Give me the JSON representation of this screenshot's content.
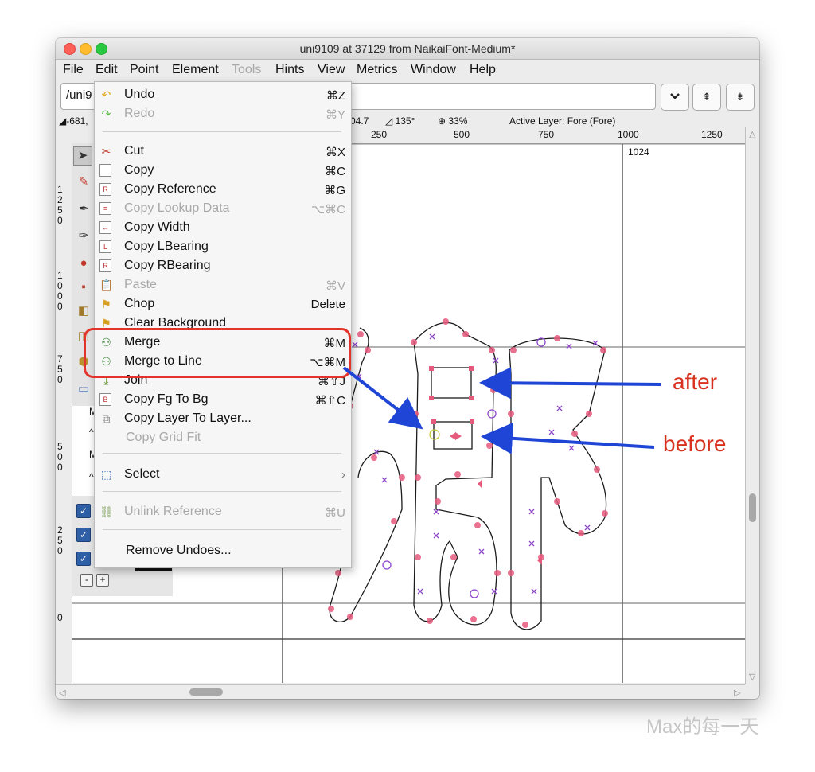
{
  "window": {
    "title": "uni9109 at 37129 from NaikaiFont-Medium*"
  },
  "menubar": {
    "items": [
      "File",
      "Edit",
      "Point",
      "Element",
      "Tools",
      "Hints",
      "View",
      "Metrics",
      "Window",
      "Help"
    ],
    "disabled": [
      "Tools"
    ]
  },
  "toolbar": {
    "glyph_name_value": "/uni9",
    "chevron_down_icon": "chevron-down-icon",
    "prev_label": "⇞",
    "next_label": "⇟"
  },
  "info": {
    "coords": "-681,",
    "value": "04.7",
    "angle": "135°",
    "zoom": "33%",
    "active_layer": "Active Layer: Fore (Fore)"
  },
  "ruler": {
    "top": [
      "250",
      "500",
      "750",
      "1000",
      "1250"
    ],
    "width_marker": "1024",
    "left": [
      "1\n2\n5\n0",
      "1\n0\n0\n0",
      "7\n5\n0",
      "5\n0\n0",
      "2\n5\n0",
      "0"
    ]
  },
  "palette": {
    "mse_labels": [
      "Mse",
      "^Ms",
      "Mse",
      "^Ms"
    ],
    "minus": "-",
    "plus": "+",
    "check": "✓"
  },
  "edit_menu": {
    "items": [
      {
        "label": "Undo",
        "shortcut": "⌘Z",
        "enabled": true,
        "icon": "undo-icon"
      },
      {
        "label": "Redo",
        "shortcut": "⌘Y",
        "enabled": false,
        "icon": "redo-icon"
      },
      {
        "label": "Cut",
        "shortcut": "⌘X",
        "enabled": true,
        "icon": "scissors-icon"
      },
      {
        "label": "Copy",
        "shortcut": "⌘C",
        "enabled": true,
        "icon": "copy-icon"
      },
      {
        "label": "Copy Reference",
        "shortcut": "⌘G",
        "enabled": true,
        "icon": "copy-reference-icon"
      },
      {
        "label": "Copy Lookup Data",
        "shortcut": "⌥⌘C",
        "enabled": false,
        "icon": "copy-lookup-icon"
      },
      {
        "label": "Copy Width",
        "shortcut": "",
        "enabled": true,
        "icon": "copy-width-icon"
      },
      {
        "label": "Copy LBearing",
        "shortcut": "",
        "enabled": true,
        "icon": "copy-lbearing-icon"
      },
      {
        "label": "Copy RBearing",
        "shortcut": "",
        "enabled": true,
        "icon": "copy-rbearing-icon"
      },
      {
        "label": "Paste",
        "shortcut": "⌘V",
        "enabled": false,
        "icon": "paste-icon"
      },
      {
        "label": "Chop",
        "shortcut": "Delete",
        "enabled": true,
        "icon": "broom-icon"
      },
      {
        "label": "Clear Background",
        "shortcut": "",
        "enabled": true,
        "icon": "clear-background-icon"
      },
      {
        "label": "Merge",
        "shortcut": "⌘M",
        "enabled": true,
        "icon": "merge-icon"
      },
      {
        "label": "Merge to Line",
        "shortcut": "⌥⌘M",
        "enabled": true,
        "icon": "merge-to-line-icon"
      },
      {
        "label": "Join",
        "shortcut": "⌘⇧J",
        "enabled": true,
        "icon": "join-icon"
      },
      {
        "label": "Copy Fg To Bg",
        "shortcut": "⌘⇧C",
        "enabled": true,
        "icon": "copy-fg-to-bg-icon"
      },
      {
        "label": "Copy Layer To Layer...",
        "shortcut": "",
        "enabled": true,
        "icon": "copy-layer-icon"
      },
      {
        "label": "Copy Grid Fit",
        "shortcut": "",
        "enabled": false,
        "icon": ""
      },
      {
        "label": "Select",
        "shortcut": "›",
        "enabled": true,
        "icon": "select-arrow-icon"
      },
      {
        "label": "Unlink Reference",
        "shortcut": "⌘U",
        "enabled": false,
        "icon": "unlink-icon"
      },
      {
        "label": "Remove Undoes...",
        "shortcut": "",
        "enabled": true,
        "icon": ""
      }
    ]
  },
  "annotations": {
    "after": "after",
    "before": "before"
  },
  "watermark": "Max的每一天",
  "colors": {
    "highlight": "#e2342b",
    "arrow": "#1f45d6",
    "outline_point": "#e0457a",
    "control_point": "#9b3fc9"
  }
}
